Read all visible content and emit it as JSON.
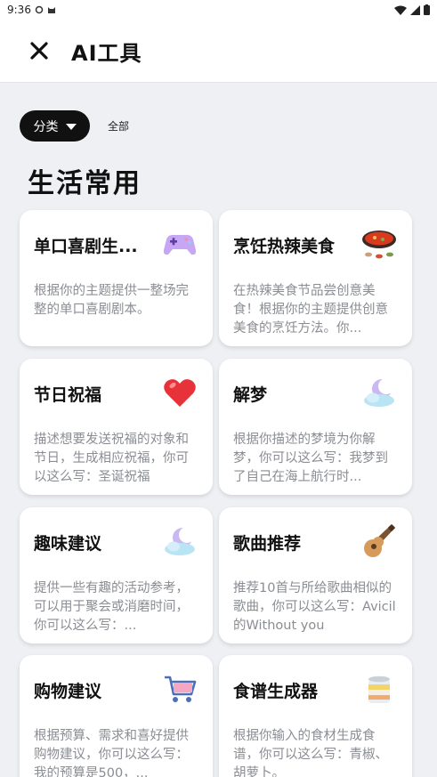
{
  "status_bar": {
    "time": "9:36"
  },
  "app_bar": {
    "title": "AI工具"
  },
  "filter": {
    "category_label": "分类",
    "all_label": "全部"
  },
  "section": {
    "title": "生活常用"
  },
  "cards": [
    {
      "title": "单口喜剧生...",
      "desc": "根据你的主题提供一整场完整的单口喜剧剧本。",
      "icon": "game-controller-icon"
    },
    {
      "title": "烹饪热辣美食",
      "desc": "在热辣美食节品尝创意美食！根据你的主题提供创意美食的烹饪方法。你...",
      "icon": "hotpot-icon"
    },
    {
      "title": "节日祝福",
      "desc": "描述想要发送祝福的对象和节日，生成相应祝福，你可以这么写：圣诞祝福",
      "icon": "heart-icon"
    },
    {
      "title": "解梦",
      "desc": "根据你描述的梦境为你解梦，你可以这么写：我梦到了自己在海上航行时...",
      "icon": "moon-cloud-icon"
    },
    {
      "title": "趣味建议",
      "desc": "提供一些有趣的活动参考，可以用于聚会或消磨时间，你可以这么写：...",
      "icon": "moon-cloud-icon"
    },
    {
      "title": "歌曲推荐",
      "desc": "推荐10首与所给歌曲相似的歌曲，你可以这么写：Avicil的Without you",
      "icon": "guitar-icon"
    },
    {
      "title": "购物建议",
      "desc": "根据预算、需求和喜好提供购物建议，你可以这么写：我的预算是500，...",
      "icon": "shopping-cart-icon"
    },
    {
      "title": "食谱生成器",
      "desc": "根据你输入的食材生成食谱，你可以这么写：青椒、胡萝卜。",
      "icon": "cake-jar-icon"
    }
  ]
}
